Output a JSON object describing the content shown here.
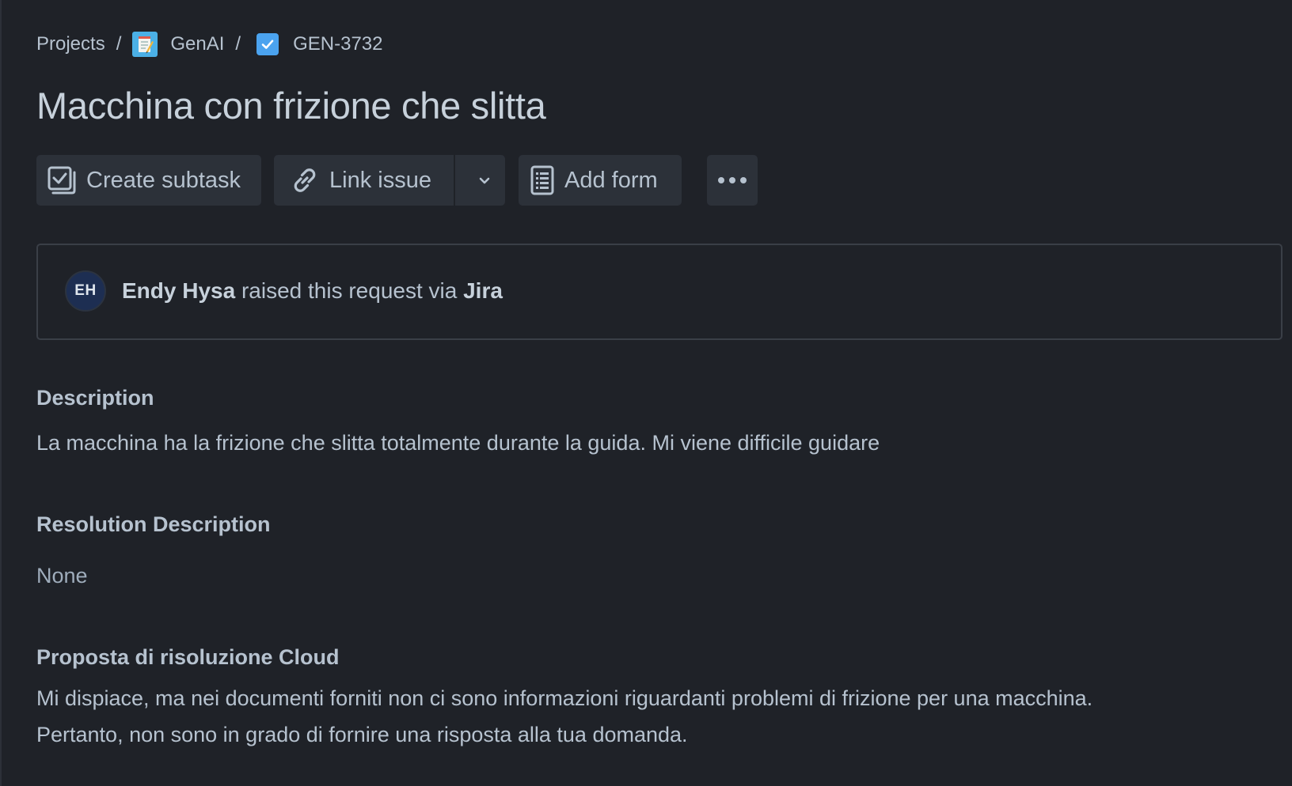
{
  "breadcrumb": {
    "projects": "Projects",
    "project": "GenAI",
    "issue_key": "GEN-3732",
    "separator": "/"
  },
  "issue": {
    "title": "Macchina con frizione che slitta"
  },
  "toolbar": {
    "create_subtask": "Create subtask",
    "link_issue": "Link issue",
    "add_form": "Add form"
  },
  "request": {
    "avatar_initials": "EH",
    "reporter": "Endy Hysa",
    "middle": " raised this request via ",
    "channel": "Jira"
  },
  "description": {
    "heading": "Description",
    "text": "La macchina ha la frizione che slitta totalmente durante la guida. Mi viene difficile guidare"
  },
  "resolution": {
    "heading": "Resolution Description",
    "text": "None"
  },
  "proposal": {
    "heading": "Proposta di risoluzione Cloud",
    "line1": "Mi dispiace, ma nei documenti forniti non ci sono informazioni riguardanti problemi di frizione per una macchina.",
    "line2": "Pertanto, non sono in grado di fornire una risposta alla tua domanda."
  },
  "colors": {
    "background": "#1f2228",
    "button_bg": "#2c3139",
    "text": "#b6c2cf",
    "task_icon": "#4ba3ef"
  },
  "icons": {
    "project": "notepad-icon",
    "issue_type": "task-checkbox-icon",
    "subtask": "subtask-icon",
    "link": "link-icon",
    "dropdown": "chevron-down-icon",
    "form": "form-icon",
    "more": "more-icon"
  }
}
